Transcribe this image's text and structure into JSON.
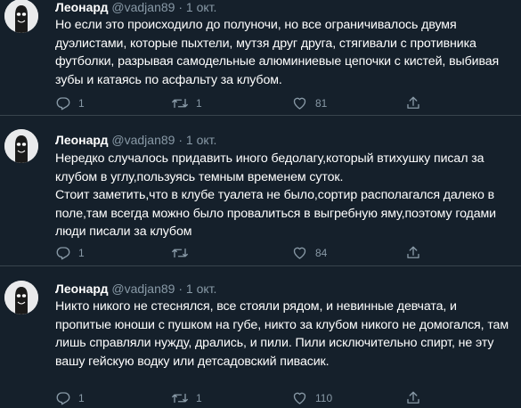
{
  "tweets": [
    {
      "name": "Леонард",
      "handle": "@vadjan89",
      "separator": "·",
      "date": "1 окт.",
      "text": "Но если это происходило до полуночи, но все ограничивалось двумя дуэлистами, которые пыхтели, мутзя друг друга, стягивали с противника футболки, разрывая самодельные алюминиевые цепочки с кистей, выбивая зубы и катаясь по асфальту за клубом.",
      "replies": "1",
      "retweets": "1",
      "likes": "81"
    },
    {
      "name": "Леонард",
      "handle": "@vadjan89",
      "separator": "·",
      "date": "1 окт.",
      "text": "Нередко случалось придавить иного бедолагу,который втихушку писал за клубом в углу,пользуясь темным временем суток.\nСтоит заметить,что в клубе туалета не было,сортир располагался далеко в поле,там всегда можно было провалиться в выгребную яму,поэтому годами люди писали за клубом",
      "replies": "1",
      "retweets": "",
      "likes": "84"
    },
    {
      "name": "Леонард",
      "handle": "@vadjan89",
      "separator": "·",
      "date": "1 окт.",
      "text": "Никто никого не стеснялся, все стояли рядом, и невинные девчата, и пропитые юноши с пушком на губе, никто за клубом никого не домогался, там лишь справляли нужду, дрались, и пили. Пили исключительно спирт, не эту вашу гейскую водку или детсадовский пивасик.",
      "replies": "1",
      "retweets": "1",
      "likes": "110"
    }
  ],
  "colors": {
    "background": "#15202b",
    "text": "#ffffff",
    "secondary": "#8899a6",
    "divider": "#38444d"
  },
  "icons": [
    "reply-icon",
    "retweet-icon",
    "like-icon",
    "share-icon",
    "avatar-mask-icon"
  ]
}
